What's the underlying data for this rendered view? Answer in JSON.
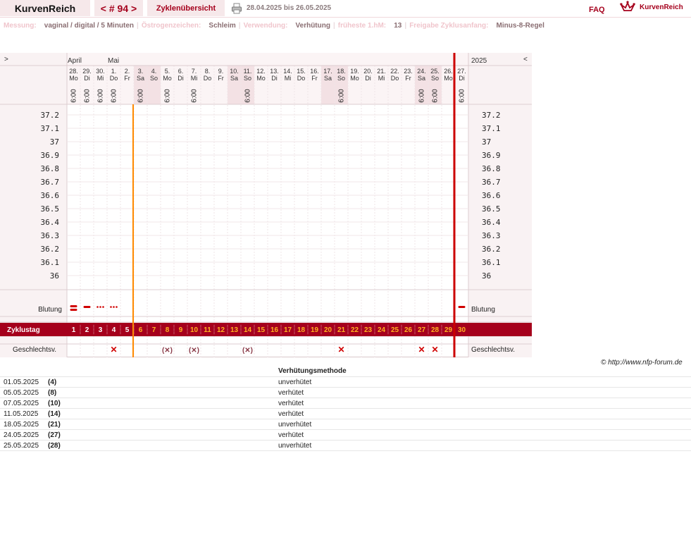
{
  "header": {
    "title": "KurvenReich",
    "cycle_nav": "< # 94 >",
    "cycle_overview": "Zyklenübersicht",
    "date_range": "28.04.2025 bis 26.05.2025",
    "faq": "FAQ",
    "logo_text": "KurvenReich"
  },
  "settings": [
    {
      "label": "Messung:",
      "value": "vaginal / digital / 5 Minuten"
    },
    {
      "label": "Östrogenzeichen:",
      "value": "Schleim"
    },
    {
      "label": "Verwendung:",
      "value": "Verhütung"
    },
    {
      "label": "früheste 1.hM:",
      "value": "13"
    },
    {
      "label": "Freigabe Zyklusanfang:",
      "value": "Minus-8-Regel"
    }
  ],
  "chart": {
    "nav_prev": ">",
    "nav_next": "<",
    "year": "2025",
    "months": [
      "April",
      "Mai"
    ],
    "days": [
      {
        "d": "28.",
        "w": "Mo",
        "t": "6:00",
        "we": false
      },
      {
        "d": "29.",
        "w": "Di",
        "t": "6:00",
        "we": false
      },
      {
        "d": "30.",
        "w": "Mi",
        "t": "6:00",
        "we": false
      },
      {
        "d": "1.",
        "w": "Do",
        "t": "6:00",
        "we": false
      },
      {
        "d": "2.",
        "w": "Fr",
        "t": "",
        "we": false
      },
      {
        "d": "3.",
        "w": "Sa",
        "t": "6:00",
        "we": true
      },
      {
        "d": "4.",
        "w": "So",
        "t": "",
        "we": true
      },
      {
        "d": "5.",
        "w": "Mo",
        "t": "6:00",
        "we": false
      },
      {
        "d": "6.",
        "w": "Di",
        "t": "",
        "we": false
      },
      {
        "d": "7.",
        "w": "Mi",
        "t": "6:00",
        "we": false
      },
      {
        "d": "8.",
        "w": "Do",
        "t": "",
        "we": false
      },
      {
        "d": "9.",
        "w": "Fr",
        "t": "",
        "we": false
      },
      {
        "d": "10.",
        "w": "Sa",
        "t": "",
        "we": true
      },
      {
        "d": "11.",
        "w": "So",
        "t": "6:00",
        "we": true
      },
      {
        "d": "12.",
        "w": "Mo",
        "t": "",
        "we": false
      },
      {
        "d": "13.",
        "w": "Di",
        "t": "",
        "we": false
      },
      {
        "d": "14.",
        "w": "Mi",
        "t": "",
        "we": false
      },
      {
        "d": "15.",
        "w": "Do",
        "t": "",
        "we": false
      },
      {
        "d": "16.",
        "w": "Fr",
        "t": "",
        "we": false
      },
      {
        "d": "17.",
        "w": "Sa",
        "t": "",
        "we": true
      },
      {
        "d": "18.",
        "w": "So",
        "t": "6:00",
        "we": true
      },
      {
        "d": "19.",
        "w": "Mo",
        "t": "",
        "we": false
      },
      {
        "d": "20.",
        "w": "Di",
        "t": "",
        "we": false
      },
      {
        "d": "21.",
        "w": "Mi",
        "t": "",
        "we": false
      },
      {
        "d": "22.",
        "w": "Do",
        "t": "",
        "we": false
      },
      {
        "d": "23.",
        "w": "Fr",
        "t": "",
        "we": false
      },
      {
        "d": "24.",
        "w": "Sa",
        "t": "6:00",
        "we": true
      },
      {
        "d": "25.",
        "w": "So",
        "t": "6:00",
        "we": true
      },
      {
        "d": "26.",
        "w": "Mo",
        "t": "",
        "we": false
      },
      {
        "d": "27.",
        "w": "Di",
        "t": "6:00",
        "we": false
      }
    ],
    "temp_scale": [
      "37.2",
      "37.1",
      "37",
      "36.9",
      "36.8",
      "36.7",
      "36.6",
      "36.5",
      "36.4",
      "36.3",
      "36.2",
      "36.1",
      "36"
    ],
    "bleeding_label": "Blutung",
    "bleeding": [
      {
        "day": 1,
        "type": "heavy"
      },
      {
        "day": 2,
        "type": "normal"
      },
      {
        "day": 3,
        "type": "spotting"
      },
      {
        "day": 4,
        "type": "spotting"
      },
      {
        "day": 30,
        "type": "normal"
      }
    ],
    "cycle_day_label": "Zyklustag",
    "cycle_days": [
      "1",
      "2",
      "3",
      "4",
      "5",
      "6",
      "7",
      "8",
      "9",
      "10",
      "11",
      "12",
      "13",
      "14",
      "15",
      "16",
      "17",
      "18",
      "19",
      "20",
      "21",
      "22",
      "23",
      "24",
      "25",
      "26",
      "27",
      "28",
      "29",
      "30"
    ],
    "intercourse_label": "Geschlechtsv.",
    "intercourse": [
      {
        "day": 4,
        "mark": "✕"
      },
      {
        "day": 8,
        "mark": "(✕)"
      },
      {
        "day": 10,
        "mark": "(✕)"
      },
      {
        "day": 14,
        "mark": "(✕)"
      },
      {
        "day": 21,
        "mark": "✕"
      },
      {
        "day": 27,
        "mark": "✕"
      },
      {
        "day": 28,
        "mark": "✕"
      }
    ],
    "orange_line_after_day": 5,
    "red_line_after_day": 29,
    "colors": {
      "brand": "#a5001c",
      "orange": "#ff8a00",
      "weekend": "#f3e1e4",
      "grid": "#e2d6d8"
    }
  },
  "copyright": "© http://www.nfp-forum.de",
  "method_table": {
    "header": "Verhütungsmethode",
    "rows": [
      {
        "date": "01.05.2025",
        "day": "(4)",
        "method": "unverhütet"
      },
      {
        "date": "05.05.2025",
        "day": "(8)",
        "method": "verhütet"
      },
      {
        "date": "07.05.2025",
        "day": "(10)",
        "method": "verhütet"
      },
      {
        "date": "11.05.2025",
        "day": "(14)",
        "method": "verhütet"
      },
      {
        "date": "18.05.2025",
        "day": "(21)",
        "method": "unverhütet"
      },
      {
        "date": "24.05.2025",
        "day": "(27)",
        "method": "verhütet"
      },
      {
        "date": "25.05.2025",
        "day": "(28)",
        "method": "unverhütet"
      }
    ]
  }
}
